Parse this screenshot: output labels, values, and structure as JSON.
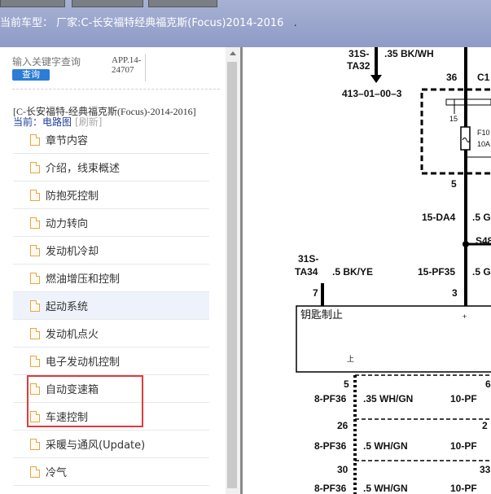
{
  "header": {
    "model_label": "当前车型：",
    "model_value": "厂家:C-长安福特经典福克斯(Focus)2014-2016",
    "trailing_dot": "."
  },
  "search": {
    "placeholder": "输入关键字查询",
    "button_label": "查询"
  },
  "app_code": {
    "line1": "APP.14-",
    "line2": "24707"
  },
  "document": {
    "title": "[C-长安福特-经典福克斯(Focus)-2014-2016]",
    "current_label": "当前：电路图",
    "refresh_label": "[刷新]"
  },
  "tree": {
    "items": [
      {
        "label": "章节内容"
      },
      {
        "label": "介绍，线束概述"
      },
      {
        "label": "防抱死控制"
      },
      {
        "label": "动力转向"
      },
      {
        "label": "发动机冷却"
      },
      {
        "label": "燃油增压和控制"
      },
      {
        "label": "起动系统"
      },
      {
        "label": "发动机点火"
      },
      {
        "label": "电子发动机控制"
      },
      {
        "label": "自动变速箱"
      },
      {
        "label": "车速控制"
      },
      {
        "label": "采暖与通风(Update)"
      },
      {
        "label": "冷气"
      }
    ]
  },
  "diagram": {
    "labels": {
      "w31s_a": "31S-",
      "ta32": "TA32",
      "bkwh": ".35 BK/WH",
      "pin36": "36",
      "c1": "C1",
      "ref": "413–01–00–3",
      "f15": "15",
      "f10": "F10",
      "a10": "10A",
      "pin5": "5",
      "da4": "15-DA4",
      "g5": ".5 G",
      "s48": "S48",
      "w31s_b": "31S-",
      "ta34": "TA34",
      "bkye": ".5 BK/YE",
      "pf35": "15-PF35",
      "g5b": ".5 G",
      "pin7": "7",
      "pin3": "3",
      "key_lock": "钥匙制止",
      "plus": "+",
      "upper": "上",
      "r5": "5",
      "r6": "6",
      "pf36a": "8-PF36",
      "whgn35": ".35 WH/GN",
      "pf10a": "10-PF",
      "r26": "26",
      "r2": "2",
      "pf36b": "8-PF36",
      "whgn5a": ".5 WH/GN",
      "pf10b": "10-PF",
      "r30": "30",
      "r33": "33",
      "pf36c": "8-PF36",
      "whgn5b": ".5 WH/GN",
      "pf10c": "10-PF"
    }
  }
}
